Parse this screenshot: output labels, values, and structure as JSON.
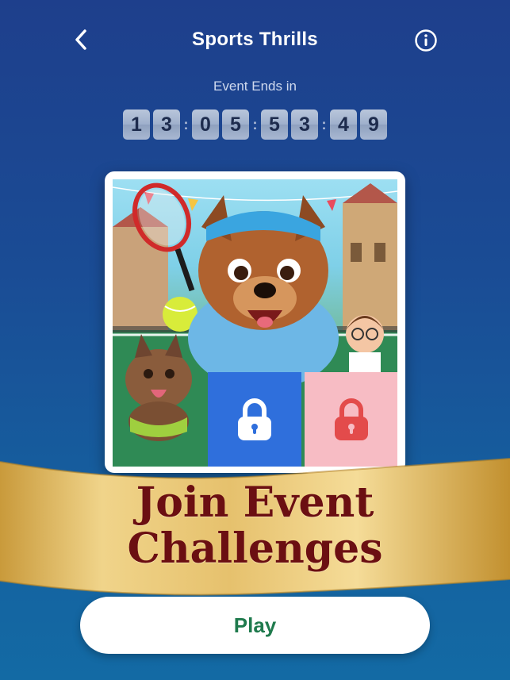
{
  "header": {
    "title": "Sports Thrills",
    "back_icon": "chevron-left-icon",
    "info_icon": "info-icon"
  },
  "event": {
    "label": "Event Ends in",
    "countdown": [
      "1",
      "3",
      "0",
      "5",
      "5",
      "3",
      "4",
      "9"
    ]
  },
  "banner": {
    "line1": "Join Event",
    "line2": "Challenges"
  },
  "puzzle": {
    "tiles": [
      {
        "icon": "lock-icon",
        "color": "#2f6fdc",
        "state": "locked"
      },
      {
        "icon": "lock-icon",
        "color": "#f7bcc4",
        "state": "locked"
      }
    ]
  },
  "play": {
    "label": "Play"
  },
  "colors": {
    "background": "#1a4c95",
    "ribbon": "#e4c06a",
    "banner_text": "#6b0f12",
    "play_text": "#1f7a4d"
  }
}
